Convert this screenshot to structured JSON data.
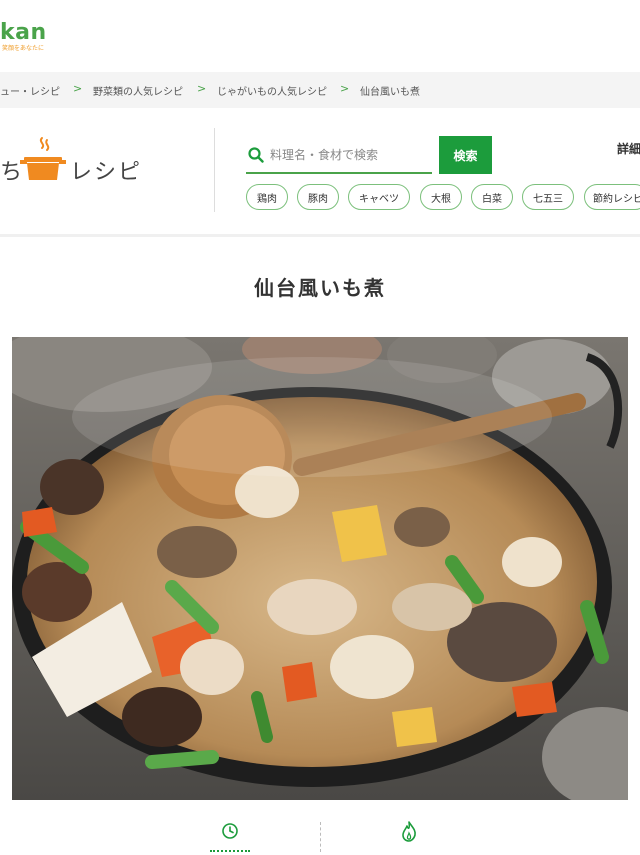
{
  "header": {
    "brand": "kan",
    "brand_tagline": "笑顔をあなたに"
  },
  "breadcrumb": {
    "items": [
      "ュー・レシピ",
      "野菜類の人気レシピ",
      "じゃがいもの人気レシピ",
      "仙台風いも煮"
    ]
  },
  "logo": {
    "left_text": "ち",
    "right_text": "レシピ"
  },
  "search": {
    "placeholder": "料理名・食材で検索",
    "button_label": "検索",
    "detail_label": "詳細"
  },
  "tags": [
    "鶏肉",
    "豚肉",
    "キャベツ",
    "大根",
    "白菜",
    "七五三",
    "節約レシピ"
  ],
  "recipe": {
    "title": "仙台風いも煮"
  },
  "colors": {
    "accent": "#1c9c3c",
    "tag_border": "#7cc07c",
    "brand": "#4aa34a"
  },
  "icons": {
    "bottom_left": "clock-icon",
    "bottom_right": "flame-icon"
  }
}
